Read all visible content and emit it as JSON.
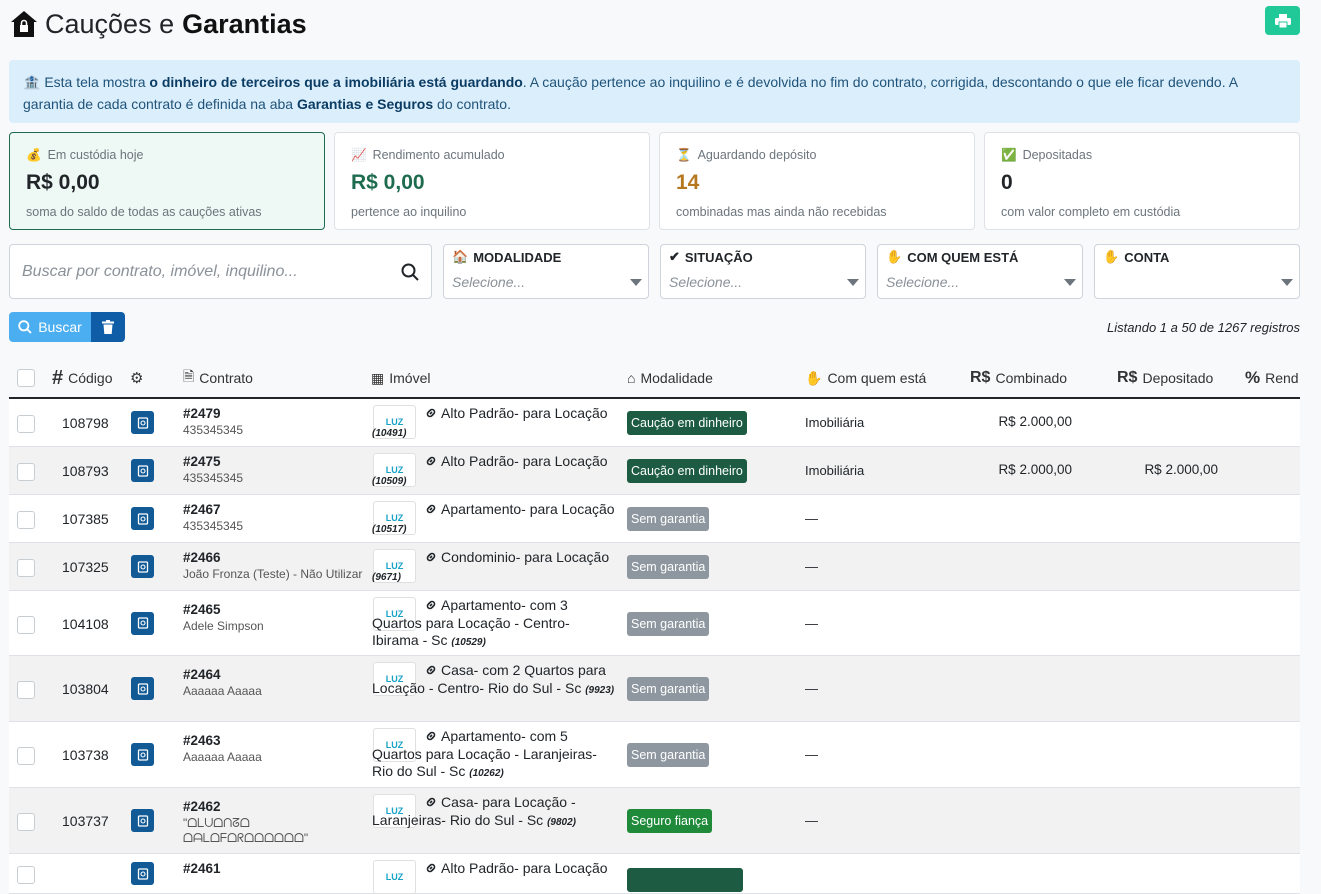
{
  "header": {
    "title_light": "Cauções e",
    "title_bold": "Garantias"
  },
  "info": {
    "p1": "Esta tela mostra ",
    "b1": "o dinheiro de terceiros que a imobiliária está guardando",
    "p2": ". A caução pertence ao inquilino e é devolvida no fim do contrato, corrigida, descontando o que ele ficar devendo. A garantia de cada contrato é definida na aba ",
    "b2": "Garantias e Seguros",
    "p3": " do contrato."
  },
  "cards": [
    {
      "label": "Em custódia hoje",
      "value": "R$ 0,00",
      "sub": "soma do saldo de todas as cauções ativas",
      "color": "#212529"
    },
    {
      "label": "Rendimento acumulado",
      "value": "R$ 0,00",
      "sub": "pertence ao inquilino",
      "color": "#1e6b4f"
    },
    {
      "label": "Aguardando depósito",
      "value": "14",
      "sub": "combinadas mas ainda não recebidas",
      "color": "#b6781f"
    },
    {
      "label": "Depositadas",
      "value": "0",
      "sub": "com valor completo em custódia",
      "color": "#212529"
    }
  ],
  "search": {
    "placeholder": "Buscar por contrato, imóvel, inquilino..."
  },
  "filters": [
    {
      "label": "MODALIDADE",
      "placeholder": "Selecione..."
    },
    {
      "label": "SITUAÇÃO",
      "placeholder": "Selecione..."
    },
    {
      "label": "COM QUEM ESTÁ",
      "placeholder": "Selecione..."
    },
    {
      "label": "CONTA",
      "placeholder": ""
    }
  ],
  "buttons": {
    "search": "Buscar"
  },
  "listing": "Listando 1 a 50 de 1267 registros",
  "columns": {
    "code": "Código",
    "contract": "Contrato",
    "property": "Imóvel",
    "modality": "Modalidade",
    "holder": "Com quem está",
    "agreed": "Combinado",
    "deposited": "Depositado",
    "yield": "Rend",
    "rs": "R$"
  },
  "logo_text": "LUZ",
  "rows": [
    {
      "code": "108798",
      "contract": "#2479",
      "tenant": "435345345",
      "property": "Alto Padrão- para Locação",
      "prop_code": "(10491)",
      "modality": "Caução em dinheiro",
      "badge": "dark",
      "holder": "Imobiliária",
      "agreed": "R$ 2.000,00",
      "deposited": ""
    },
    {
      "code": "108793",
      "contract": "#2475",
      "tenant": "435345345",
      "property": "Alto Padrão- para Locação",
      "prop_code": "(10509)",
      "modality": "Caução em dinheiro",
      "badge": "dark",
      "holder": "Imobiliária",
      "agreed": "R$ 2.000,00",
      "deposited": "R$ 2.000,00"
    },
    {
      "code": "107385",
      "contract": "#2467",
      "tenant": "435345345",
      "property": "Apartamento- para Locação",
      "prop_code": "(10517)",
      "modality": "Sem garantia",
      "badge": "gray",
      "holder": "—",
      "agreed": "",
      "deposited": ""
    },
    {
      "code": "107325",
      "contract": "#2466",
      "tenant": "João Fronza (Teste) - Não Utilizar",
      "property": "Condominio- para Locação",
      "prop_code": "(9671)",
      "modality": "Sem garantia",
      "badge": "gray",
      "holder": "—",
      "agreed": "",
      "deposited": ""
    },
    {
      "code": "104108",
      "contract": "#2465",
      "tenant": "Adele Simpson",
      "property": "Apartamento- com 3 Quartos para Locação - Centro- Ibirama - Sc",
      "prop_code": "(10529)",
      "modality": "Sem garantia",
      "badge": "gray",
      "holder": "—",
      "agreed": "",
      "deposited": ""
    },
    {
      "code": "103804",
      "contract": "#2464",
      "tenant": "Aaaaaa Aaaaa",
      "property": "Casa- com 2 Quartos para Locação - Centro- Rio do Sul - Sc",
      "prop_code": "(9923)",
      "modality": "Sem garantia",
      "badge": "gray",
      "holder": "—",
      "agreed": "",
      "deposited": ""
    },
    {
      "code": "103738",
      "contract": "#2463",
      "tenant": "Aaaaaa Aaaaa",
      "property": "Apartamento- com 5 Quartos para Locação - Laranjeiras- Rio do Sul - Sc",
      "prop_code": "(10262)",
      "modality": "Sem garantia",
      "badge": "gray",
      "holder": "—",
      "agreed": "",
      "deposited": ""
    },
    {
      "code": "103737",
      "contract": "#2462",
      "tenant": "\"ᗝᒪᑌᗝᑎᘔᗝ ᗝᗩᒪᗝᖴᗝᖇᗝᗝᗝᗝᗝᗝ\"",
      "property": "Casa- para Locação - Laranjeiras- Rio do Sul - Sc",
      "prop_code": "(9802)",
      "modality": "Seguro fiança",
      "badge": "green",
      "holder": "—",
      "agreed": "",
      "deposited": ""
    },
    {
      "code": "",
      "contract": "#2461",
      "tenant": "",
      "property": "Alto Padrão- para Locação",
      "prop_code": "",
      "modality": "",
      "badge": "dark",
      "holder": "",
      "agreed": "",
      "deposited": ""
    }
  ]
}
